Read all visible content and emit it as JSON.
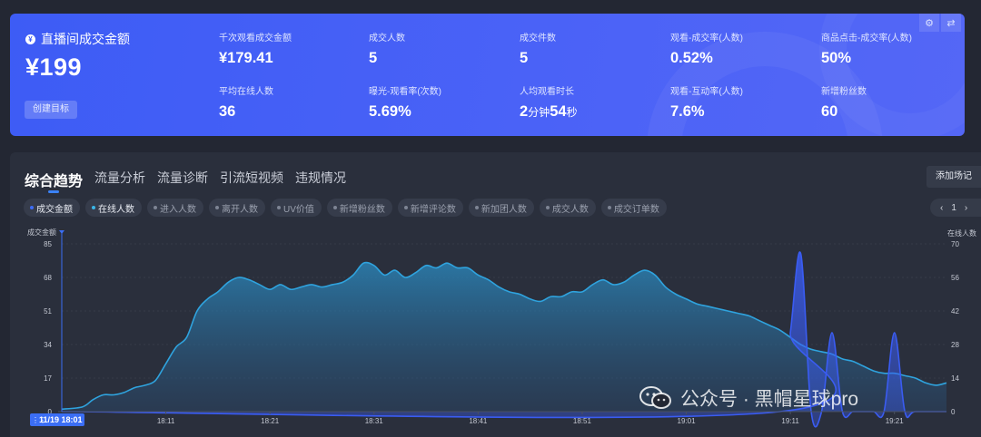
{
  "summary": {
    "gmv_label": "直播间成交金额",
    "gmv_value": "¥199",
    "goal_button": "创建目标",
    "metrics": [
      {
        "label": "千次观看成交金额",
        "value": "¥179.41"
      },
      {
        "label": "成交人数",
        "value": "5"
      },
      {
        "label": "成交件数",
        "value": "5"
      },
      {
        "label": "观看-成交率(人数)",
        "value": "0.52%"
      },
      {
        "label": "商品点击-成交率(人数)",
        "value": "50%"
      },
      {
        "label": "平均在线人数",
        "value": "36"
      },
      {
        "label": "曝光-观看率(次数)",
        "value": "5.69%"
      },
      {
        "label": "人均观看时长",
        "value_min": "2",
        "unit_min": "分钟",
        "value_sec": "54",
        "unit_sec": "秒"
      },
      {
        "label": "观看-互动率(人数)",
        "value": "7.6%"
      },
      {
        "label": "新增粉丝数",
        "value": "60"
      }
    ],
    "icons": [
      "gear-icon",
      "swap-icon"
    ]
  },
  "tabs": [
    "综合趋势",
    "流量分析",
    "流量诊断",
    "引流短视频",
    "违规情况"
  ],
  "add_button": "添加场记",
  "chips": [
    {
      "label": "成交金额",
      "active": true,
      "color": "#3d6cf5"
    },
    {
      "label": "在线人数",
      "active": true,
      "color": "#3ab6e8"
    },
    {
      "label": "进入人数",
      "active": false
    },
    {
      "label": "离开人数",
      "active": false
    },
    {
      "label": "UV价值",
      "active": false
    },
    {
      "label": "新增粉丝数",
      "active": false
    },
    {
      "label": "新增评论数",
      "active": false
    },
    {
      "label": "新加团人数",
      "active": false
    },
    {
      "label": "成交人数",
      "active": false
    },
    {
      "label": "成交订单数",
      "active": false
    }
  ],
  "pager": {
    "prev": "‹",
    "page": "1",
    "next": "›"
  },
  "watermark": "公众号 · 黑帽星球pro",
  "chart_data": {
    "type": "area",
    "left_axis_label": "成交金额",
    "right_axis_label": "在线人数",
    "y_left_ticks": [
      0,
      17,
      34,
      51,
      68,
      85
    ],
    "y_right_ticks": [
      0,
      14,
      28,
      42,
      56,
      70
    ],
    "ylim_left": [
      0,
      85
    ],
    "ylim_right": [
      0,
      70
    ],
    "x_ticks": [
      "18:11",
      "18:21",
      "18:31",
      "18:41",
      "18:51",
      "19:01",
      "19:11",
      "19:21"
    ],
    "xlim_minutes": [
      0,
      85
    ],
    "cursor_label": "11/19 18:01",
    "colors": {
      "online": "#2fa3de",
      "gmv": "#3a5cf2"
    },
    "series": [
      {
        "name": "在线人数",
        "axis": "right",
        "x_minutes": [
          0,
          2,
          3,
          4,
          5,
          6,
          7,
          8,
          9,
          10,
          11,
          12,
          13,
          14,
          15,
          16,
          17,
          18,
          19,
          20,
          21,
          22,
          23,
          24,
          25,
          26,
          27,
          28,
          29,
          30,
          31,
          32,
          33,
          34,
          35,
          36,
          37,
          38,
          39,
          40,
          41,
          42,
          43,
          44,
          45,
          46,
          47,
          48,
          49,
          50,
          51,
          52,
          53,
          54,
          55,
          56,
          57,
          58,
          59,
          60,
          61,
          62,
          63,
          64,
          65,
          66,
          67,
          68,
          69,
          70,
          71,
          72,
          73,
          74,
          75,
          76,
          77,
          78,
          79,
          80,
          81,
          82,
          83,
          84,
          85
        ],
        "values": [
          1,
          2,
          5,
          7,
          7,
          8,
          10,
          11,
          13,
          20,
          27,
          31,
          42,
          47,
          50,
          54,
          56,
          55,
          53,
          51,
          53,
          51,
          52,
          53,
          52,
          53,
          54,
          57,
          62,
          61,
          57,
          59,
          56,
          58,
          61,
          60,
          62,
          60,
          60,
          57,
          55,
          52,
          50,
          49,
          47,
          46,
          48,
          48,
          50,
          50,
          53,
          55,
          53,
          54,
          57,
          59,
          57,
          52,
          49,
          47,
          45,
          44,
          43,
          42,
          41,
          40,
          38,
          36,
          34,
          31,
          28,
          26,
          25,
          24,
          22,
          21,
          19,
          17,
          16,
          16,
          15,
          14,
          12,
          11,
          12
        ]
      },
      {
        "name": "成交金额",
        "axis": "left",
        "x_minutes": [
          0,
          69,
          70,
          71,
          72,
          73,
          74,
          75,
          76,
          77,
          78,
          79,
          80,
          81,
          82,
          85
        ],
        "values": [
          0,
          0,
          40,
          80,
          0,
          0,
          40,
          0,
          0,
          0,
          0,
          0,
          40,
          0,
          0,
          0
        ]
      }
    ]
  }
}
